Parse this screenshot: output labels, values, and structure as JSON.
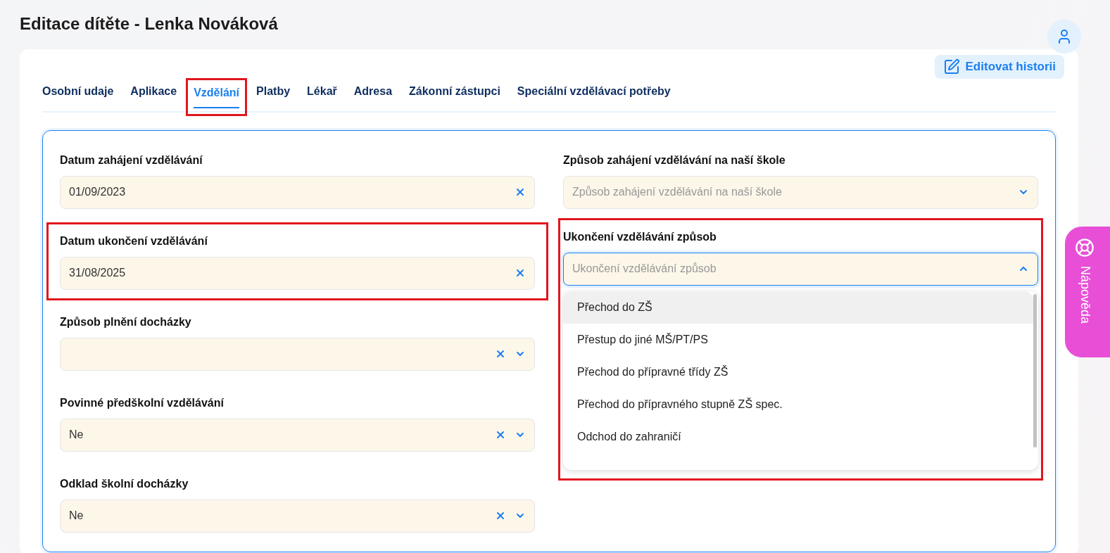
{
  "page": {
    "title": "Editace dítěte - Lenka Nováková"
  },
  "edit_history_button": "Editovat historii",
  "help_tab": "Nápověda",
  "tabs": [
    {
      "label": "Osobní udaje",
      "selected": false,
      "highlighted": false
    },
    {
      "label": "Aplikace",
      "selected": false,
      "highlighted": false
    },
    {
      "label": "Vzdělání",
      "selected": true,
      "highlighted": true
    },
    {
      "label": "Platby",
      "selected": false,
      "highlighted": false
    },
    {
      "label": "Lékař",
      "selected": false,
      "highlighted": false
    },
    {
      "label": "Adresa",
      "selected": false,
      "highlighted": false
    },
    {
      "label": "Zákonní zástupci",
      "selected": false,
      "highlighted": false
    },
    {
      "label": "Speciální vzdělávací potřeby",
      "selected": false,
      "highlighted": false
    }
  ],
  "left_column": [
    {
      "label": "Datum zahájení vzdělávání",
      "kind": "date",
      "value": "01/09/2023",
      "highlighted": false
    },
    {
      "label": "Datum ukončení vzdělávání",
      "kind": "date",
      "value": "31/08/2025",
      "highlighted": true
    },
    {
      "label": "Způsob plnění docházky",
      "kind": "select",
      "highlighted": false
    },
    {
      "label": "Povinné předškolní vzdělávání",
      "kind": "select",
      "value": "Ne",
      "highlighted": false
    },
    {
      "label": "Odklad školní docházky",
      "kind": "select",
      "value": "Ne",
      "highlighted": false
    }
  ],
  "right_column": [
    {
      "label": "Způsob zahájení vzdělávání na naší škole",
      "placeholder": "Způsob zahájení vzdělávání na naší škole",
      "open": false,
      "highlighted": false
    },
    {
      "label": "Ukončení vzdělávání způsob",
      "placeholder": "Ukončení vzdělávání způsob",
      "open": true,
      "highlighted": true,
      "options": [
        {
          "label": "Přechod do ZŠ",
          "selected": true
        },
        {
          "label": "Přestup do jiné MŠ/PT/PS",
          "selected": false
        },
        {
          "label": "Přechod do přípravné třídy ZŠ",
          "selected": false
        },
        {
          "label": "Přechod do přípravného stupně ZŠ spec.",
          "selected": false
        },
        {
          "label": "Odchod do zahraničí",
          "selected": false
        }
      ]
    }
  ]
}
